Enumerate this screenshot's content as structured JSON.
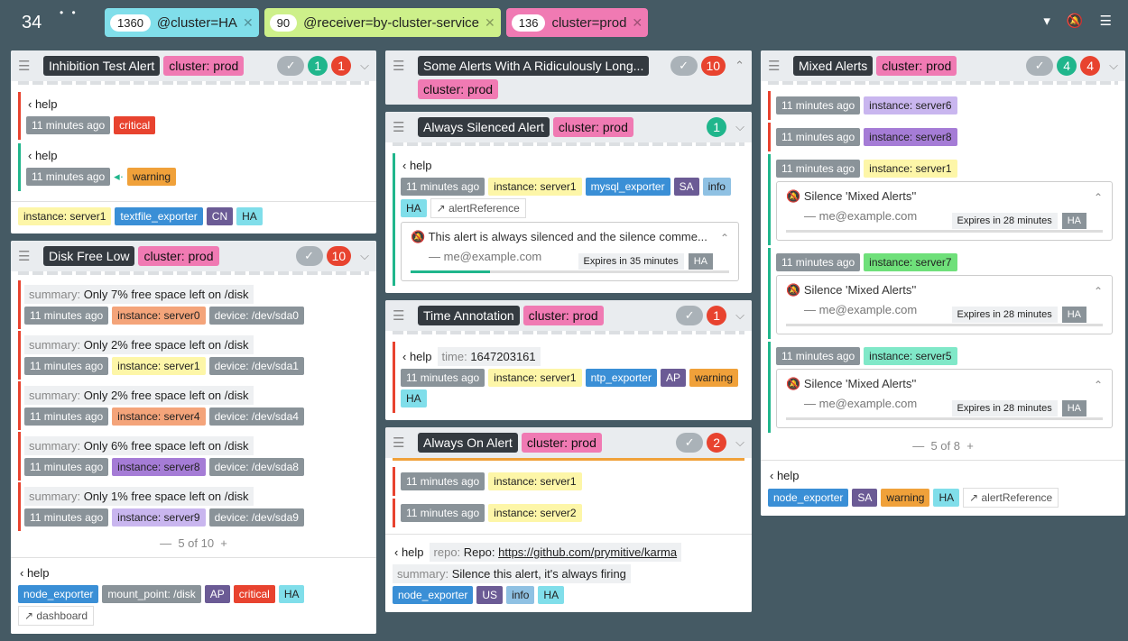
{
  "topbar": {
    "count": "34",
    "filters": [
      {
        "num": "1360",
        "text": "@cluster=HA",
        "color": "#80deea"
      },
      {
        "num": "90",
        "text": "@receiver=by-cluster-service",
        "color": "#cdf08a"
      },
      {
        "num": "136",
        "text": "cluster=prod",
        "color": "#f07ab3"
      }
    ]
  },
  "c1": {
    "name": "Inhibition Test Alert",
    "cluster": "cluster: prod",
    "green": "1",
    "red": "1",
    "g1": {
      "help": "help",
      "time": "11 minutes ago",
      "sev": "critical"
    },
    "g2": {
      "help": "help",
      "time": "11 minutes ago",
      "sev": "warning"
    },
    "labels": [
      "instance: server1",
      "textfile_exporter",
      "CN",
      "HA"
    ]
  },
  "c2": {
    "name": "Disk Free Low",
    "cluster": "cluster: prod",
    "red": "10",
    "items": [
      {
        "k": "summary:",
        "v": "Only 7% free space left on /disk",
        "inst": "instance: server0",
        "ic": "#f4a47a",
        "dev": "device: /dev/sda0"
      },
      {
        "k": "summary:",
        "v": "Only 2% free space left on /disk",
        "inst": "instance: server1",
        "ic": "#fdf6a8",
        "dev": "device: /dev/sda1"
      },
      {
        "k": "summary:",
        "v": "Only 2% free space left on /disk",
        "inst": "instance: server4",
        "ic": "#f4a47a",
        "dev": "device: /dev/sda4"
      },
      {
        "k": "summary:",
        "v": "Only 6% free space left on /disk",
        "inst": "instance: server8",
        "ic": "#a57cd6",
        "dev": "device: /dev/sda8"
      },
      {
        "k": "summary:",
        "v": "Only 1% free space left on /disk",
        "inst": "instance: server9",
        "ic": "#c9b6ef",
        "dev": "device: /dev/sda9"
      }
    ],
    "time": "11 minutes ago",
    "pager": "5 of 10",
    "help": "help",
    "labels": [
      "node_exporter",
      "mount_point: /disk",
      "AP",
      "critical",
      "HA"
    ],
    "dash": "dashboard"
  },
  "c3": {
    "name": "Some Alerts With A Ridiculously Long...",
    "cluster": "cluster: prod",
    "red": "10"
  },
  "c4": {
    "name": "Always Silenced Alert",
    "cluster": "cluster: prod",
    "green": "1",
    "help": "help",
    "time": "11 minutes ago",
    "labels": [
      "instance: server1",
      "mysql_exporter",
      "SA",
      "info",
      "HA"
    ],
    "ref": "alertReference",
    "sil": "This alert is always silenced and the silence comme...",
    "by": "— me@example.com",
    "exp": "Expires in 35 minutes",
    "ha": "HA"
  },
  "c5": {
    "name": "Time Annotation",
    "cluster": "cluster: prod",
    "red": "1",
    "help": "help",
    "k": "time:",
    "v": "1647203161",
    "time": "11 minutes ago",
    "labels": [
      "instance: server1",
      "ntp_exporter",
      "AP",
      "warning",
      "HA"
    ]
  },
  "c6": {
    "name": "Always On Alert",
    "cluster": "cluster: prod",
    "red": "2",
    "time": "11 minutes ago",
    "i1": "instance: server1",
    "i2": "instance: server2",
    "help": "help",
    "rk": "repo:",
    "rv": "Repo:",
    "url": "https://github.com/prymitive/karma",
    "sk": "summary:",
    "sv": "Silence this alert, it's always firing",
    "labels": [
      "node_exporter",
      "US",
      "info",
      "HA"
    ]
  },
  "c7": {
    "name": "Mixed Alerts",
    "cluster": "cluster: prod",
    "green": "4",
    "red": "4",
    "time": "11 minutes ago",
    "insts": [
      {
        "t": "instance: server6",
        "c": "#c9b6ef"
      },
      {
        "t": "instance: server8",
        "c": "#a57cd6"
      },
      {
        "t": "instance: server1",
        "c": "#fdf6a8"
      },
      {
        "t": "instance: server7",
        "c": "#6fe07a"
      },
      {
        "t": "instance: server5",
        "c": "#80e8c8"
      }
    ],
    "sil": "Silence 'Mixed Alerts''",
    "by": "— me@example.com",
    "exp": "Expires in 28 minutes",
    "ha": "HA",
    "pager": "5 of 8",
    "help": "help",
    "labels": [
      "node_exporter",
      "SA",
      "warning",
      "HA"
    ],
    "ref": "alertReference"
  }
}
